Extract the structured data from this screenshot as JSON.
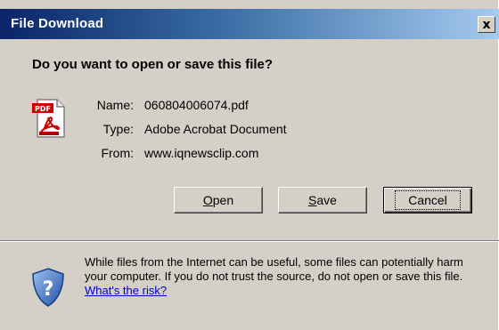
{
  "window": {
    "title": "File Download",
    "close_glyph": "x"
  },
  "dialog": {
    "question": "Do you want to open or save this file?",
    "file_icon": "pdf-file-icon",
    "fields": [
      {
        "label": "Name:",
        "value": "060804006074.pdf"
      },
      {
        "label": "Type:",
        "value": "Adobe Acrobat Document"
      },
      {
        "label": "From:",
        "value": "www.iqnewsclip.com"
      }
    ],
    "buttons": {
      "open_underlined": "O",
      "open_rest": "pen",
      "save_underlined": "S",
      "save_rest": "ave",
      "cancel": "Cancel"
    }
  },
  "warning": {
    "icon": "shield-question-icon",
    "text": "While files from the Internet can be useful, some files can potentially harm your computer. If you do not trust the source, do not open or save this file.",
    "link": "What's the risk?"
  }
}
